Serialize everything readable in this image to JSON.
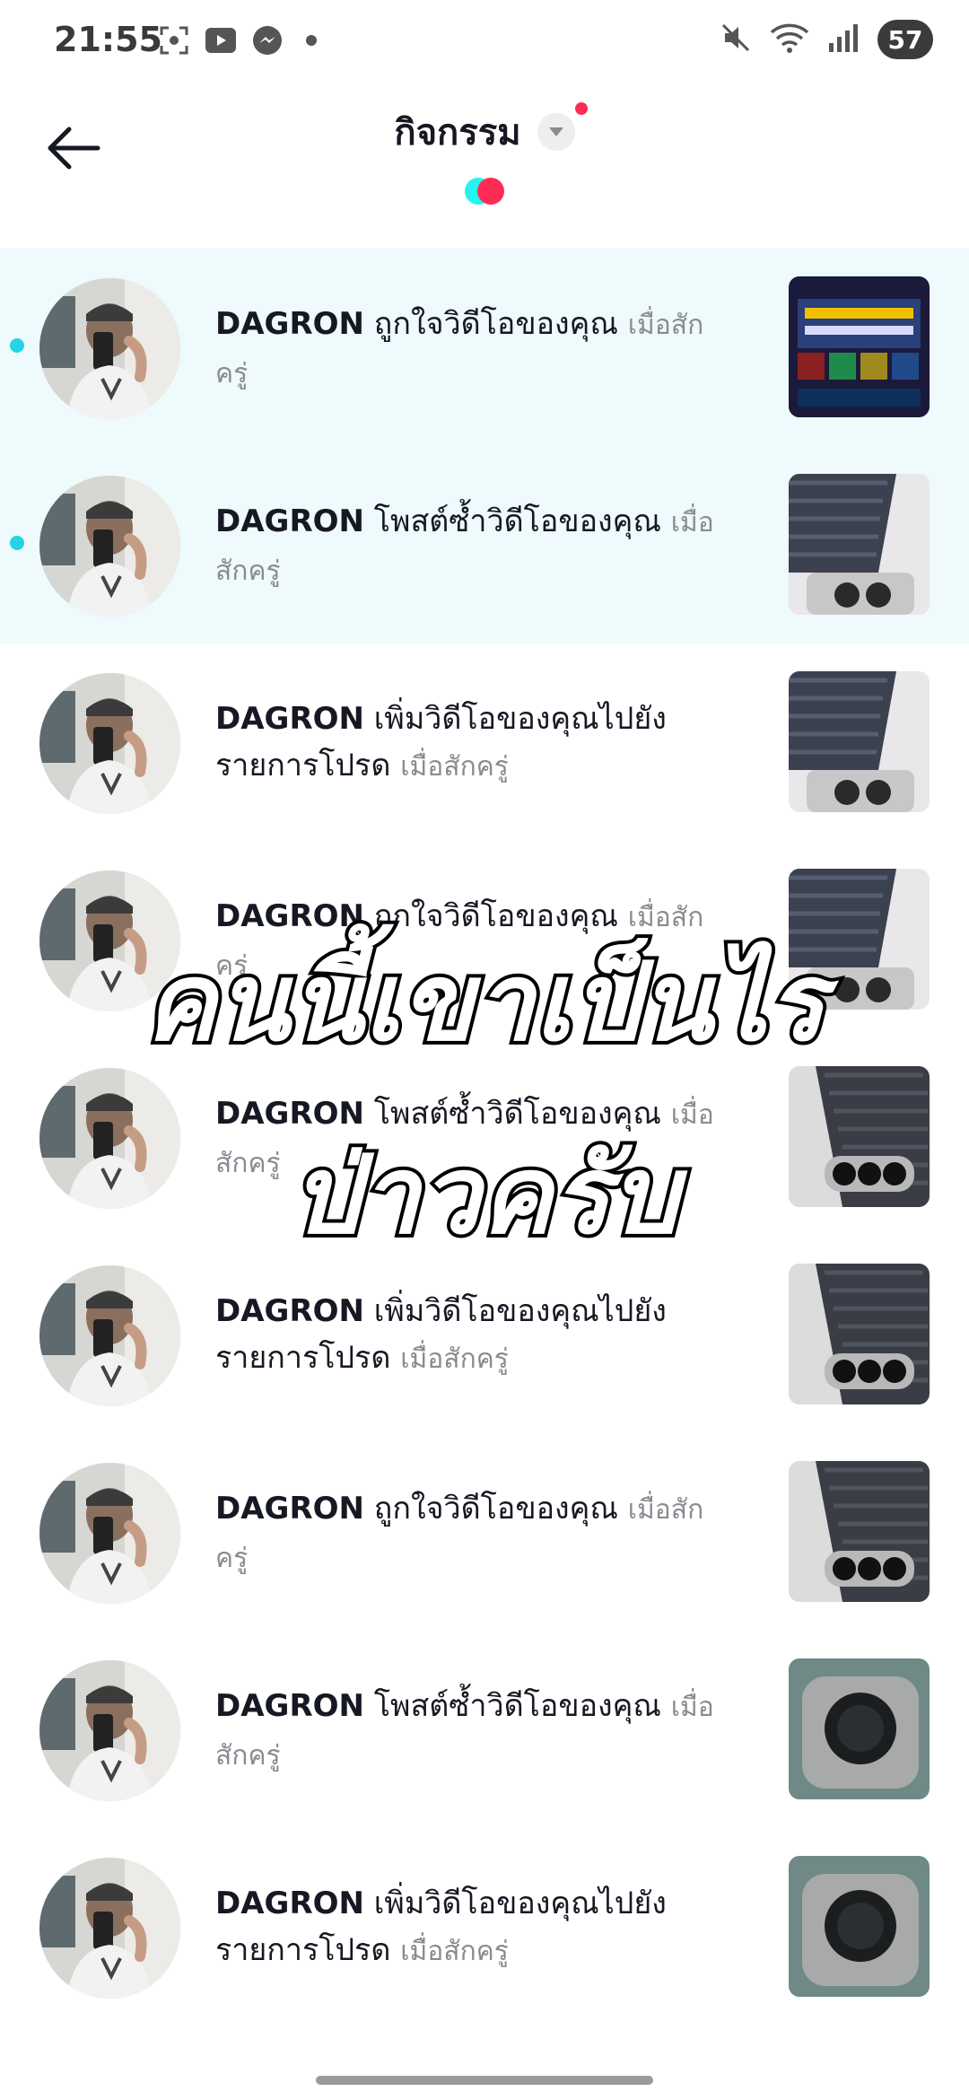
{
  "status_bar": {
    "time": "21:55",
    "left_icons": [
      "screenshot-icon",
      "youtube-icon",
      "messenger-icon",
      "notification-dot"
    ],
    "right_icons": [
      "mute-icon",
      "wifi-icon",
      "signal-icon"
    ],
    "battery": "57"
  },
  "header": {
    "title": "กิจกรรม",
    "back_icon": "back-arrow-icon",
    "dropdown_icon": "caret-down-icon"
  },
  "activity": [
    {
      "user": "DAGRON",
      "action": "ถูกใจวิดีโอของคุณ",
      "time": "เมื่อสักครู่",
      "unread": true,
      "thumb": "game"
    },
    {
      "user": "DAGRON",
      "action": "โพสต์ซ้ำวิดีโอของคุณ",
      "time": "เมื่อสักครู่",
      "unread": true,
      "thumb": "phone-carbon"
    },
    {
      "user": "DAGRON",
      "action": "เพิ่มวิดีโอของคุณไปยังรายการโปรด",
      "time": "เมื่อสักครู่",
      "unread": false,
      "thumb": "phone-carbon"
    },
    {
      "user": "DAGRON",
      "action": "ถูกใจวิดีโอของคุณ",
      "time": "เมื่อสักครู่",
      "unread": false,
      "thumb": "phone-carbon"
    },
    {
      "user": "DAGRON",
      "action": "โพสต์ซ้ำวิดีโอของคุณ",
      "time": "เมื่อสักครู่",
      "unread": false,
      "thumb": "phone-triple"
    },
    {
      "user": "DAGRON",
      "action": "เพิ่มวิดีโอของคุณไปยังรายการโปรด",
      "time": "เมื่อสักครู่",
      "unread": false,
      "thumb": "phone-triple"
    },
    {
      "user": "DAGRON",
      "action": "ถูกใจวิดีโอของคุณ",
      "time": "เมื่อสักครู่",
      "unread": false,
      "thumb": "phone-triple"
    },
    {
      "user": "DAGRON",
      "action": "โพสต์ซ้ำวิดีโอของคุณ",
      "time": "เมื่อสักครู่",
      "unread": false,
      "thumb": "phone-round"
    },
    {
      "user": "DAGRON",
      "action": "เพิ่มวิดีโอของคุณไปยังรายการโปรด",
      "time": "เมื่อสักครู่",
      "unread": false,
      "thumb": "phone-round"
    }
  ],
  "overlay_caption": {
    "line1": "คนนี้เขาเป็นไร",
    "line2": "ป่าวครับ"
  },
  "colors": {
    "unread_bg": "#eefafb",
    "unread_dot": "#25d4e4",
    "accent_red": "#fe2c55",
    "accent_cyan": "#25f4ee"
  }
}
